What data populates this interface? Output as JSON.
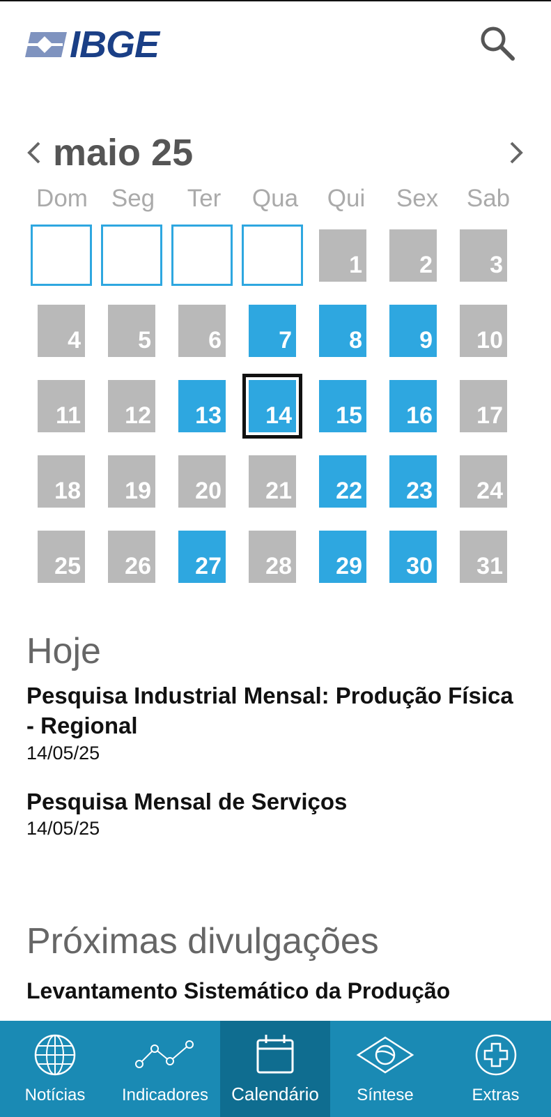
{
  "header": {
    "logo_text": "IBGE",
    "search_icon": "search-icon"
  },
  "calendar": {
    "month_title": "maio 25",
    "weekdays": [
      "Dom",
      "Seg",
      "Ter",
      "Qua",
      "Qui",
      "Sex",
      "Sab"
    ],
    "leading_empty_days": 4,
    "days": [
      {
        "day": "1",
        "highlight": false
      },
      {
        "day": "2",
        "highlight": false
      },
      {
        "day": "3",
        "highlight": false
      },
      {
        "day": "4",
        "highlight": false
      },
      {
        "day": "5",
        "highlight": false
      },
      {
        "day": "6",
        "highlight": false
      },
      {
        "day": "7",
        "highlight": true
      },
      {
        "day": "8",
        "highlight": true
      },
      {
        "day": "9",
        "highlight": true
      },
      {
        "day": "10",
        "highlight": false
      },
      {
        "day": "11",
        "highlight": false
      },
      {
        "day": "12",
        "highlight": false
      },
      {
        "day": "13",
        "highlight": true
      },
      {
        "day": "14",
        "highlight": true,
        "today": true
      },
      {
        "day": "15",
        "highlight": true
      },
      {
        "day": "16",
        "highlight": true
      },
      {
        "day": "17",
        "highlight": false
      },
      {
        "day": "18",
        "highlight": false
      },
      {
        "day": "19",
        "highlight": false
      },
      {
        "day": "20",
        "highlight": false
      },
      {
        "day": "21",
        "highlight": false
      },
      {
        "day": "22",
        "highlight": true
      },
      {
        "day": "23",
        "highlight": true
      },
      {
        "day": "24",
        "highlight": false
      },
      {
        "day": "25",
        "highlight": false
      },
      {
        "day": "26",
        "highlight": false
      },
      {
        "day": "27",
        "highlight": true
      },
      {
        "day": "28",
        "highlight": false
      },
      {
        "day": "29",
        "highlight": true
      },
      {
        "day": "30",
        "highlight": true
      },
      {
        "day": "31",
        "highlight": false
      }
    ]
  },
  "today_section": {
    "title": "Hoje",
    "items": [
      {
        "title": "Pesquisa Industrial Mensal: Produção Física - Regional",
        "date": "14/05/25"
      },
      {
        "title": "Pesquisa Mensal de Serviços",
        "date": "14/05/25"
      }
    ]
  },
  "upcoming_section": {
    "title": "Próximas divulgações",
    "items": [
      {
        "title": "Levantamento Sistemático da Produção"
      }
    ]
  },
  "bottom_nav": {
    "items": [
      {
        "label": "Notícias",
        "icon": "globe-icon"
      },
      {
        "label": "Indicadores",
        "icon": "line-chart-icon"
      },
      {
        "label": "Calendário",
        "icon": "calendar-icon",
        "active": true
      },
      {
        "label": "Síntese",
        "icon": "brazil-flag-icon"
      },
      {
        "label": "Extras",
        "icon": "plus-circle-icon"
      }
    ]
  },
  "colors": {
    "accent_blue": "#2ea7e0",
    "day_gray": "#b9b9b9",
    "nav_bg": "#1a8ab4",
    "nav_active": "#0f6d90",
    "logo_blue": "#1a3f86"
  }
}
